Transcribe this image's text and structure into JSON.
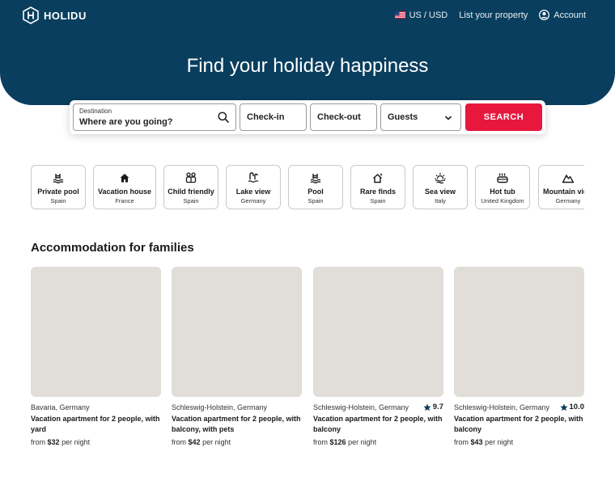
{
  "brand": {
    "name": "HOLIDU"
  },
  "nav": {
    "currency": "US / USD",
    "list_property": "List your property",
    "account": "Account"
  },
  "hero": {
    "title": "Find your holiday happiness"
  },
  "search": {
    "destination_label": "Destination",
    "destination_placeholder": "Where are you going?",
    "checkin": "Check-in",
    "checkout": "Check-out",
    "guests": "Guests",
    "button": "SEARCH"
  },
  "categories": [
    {
      "title": "Private pool",
      "sub": "Spain",
      "icon": "pool-icon"
    },
    {
      "title": "Vacation house",
      "sub": "France",
      "icon": "house-icon"
    },
    {
      "title": "Child friendly",
      "sub": "Spain",
      "icon": "family-icon"
    },
    {
      "title": "Lake view",
      "sub": "Germany",
      "icon": "lake-icon"
    },
    {
      "title": "Pool",
      "sub": "Spain",
      "icon": "pool-icon"
    },
    {
      "title": "Rare finds",
      "sub": "Spain",
      "icon": "special-house-icon"
    },
    {
      "title": "Sea view",
      "sub": "Italy",
      "icon": "sunset-icon"
    },
    {
      "title": "Hot tub",
      "sub": "United Kingdom",
      "icon": "hot-tub-icon"
    },
    {
      "title": "Mountain view",
      "sub": "Germany",
      "icon": "mountain-icon"
    }
  ],
  "section": {
    "title": "Accommodation for families"
  },
  "listings": [
    {
      "location": "Bavaria, Germany",
      "rating": "",
      "title": "Vacation apartment for 2 people, with yard",
      "price_prefix": "from",
      "price": "$32",
      "price_suffix": "per night"
    },
    {
      "location": "Schleswig-Holstein, Germany",
      "rating": "",
      "title": "Vacation apartment for 2 people, with balcony, with pets",
      "price_prefix": "from",
      "price": "$42",
      "price_suffix": "per night"
    },
    {
      "location": "Schleswig-Holstein, Germany",
      "rating": "9.7",
      "title": "Vacation apartment for 2 people, with balcony",
      "price_prefix": "from",
      "price": "$126",
      "price_suffix": "per night"
    },
    {
      "location": "Schleswig-Holstein, Germany",
      "rating": "10.0",
      "title": "Vacation apartment for 2 people, with balcony",
      "price_prefix": "from",
      "price": "$43",
      "price_suffix": "per night"
    }
  ],
  "colors": {
    "hero": "#0a3e5e",
    "accent": "#e8173d",
    "image_placeholder": "#e1ddd8"
  }
}
